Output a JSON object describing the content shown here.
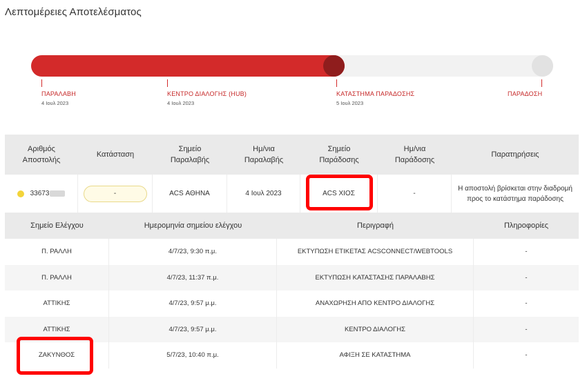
{
  "page": {
    "title": "Λεπτομέρειες Αποτελέσματος"
  },
  "progress": {
    "fraction": 0.6,
    "stages": [
      {
        "name": "ΠΑΡΑΛΑΒΗ",
        "date": "4 Ιουλ 2023"
      },
      {
        "name": "ΚΕΝΤΡΟ ΔΙΑΛΟΓΗΣ (HUB)",
        "date": "4 Ιουλ 2023"
      },
      {
        "name": "ΚΑΤΑΣΤΗΜΑ ΠΑΡΑΔΟΣΗΣ",
        "date": "5 Ιουλ 2023"
      },
      {
        "name": "ΠΑΡΑΔΟΣΗ",
        "date": ""
      }
    ]
  },
  "shipment": {
    "headers": [
      "Αριθμός Αποστολής",
      "Κατάσταση",
      "Σημείο Παραλαβής",
      "Ημ/νια Παραλαβής",
      "Σημείο Παράδοσης",
      "Ημ/νια Παράδοσης",
      "Παρατηρήσεις"
    ],
    "tracking_number": "33673",
    "status": "-",
    "pickup_point": "ACS ΑΘΗΝΑ",
    "pickup_date": "4 Ιουλ 2023",
    "delivery_point": "ACS ΧΙΟΣ",
    "delivery_date": "-",
    "notes": "Η αποστολή βρίσκεται στην διαδρομή προς το κατάστημα παράδοσης"
  },
  "checkpoints": {
    "headers": [
      "Σημείο Ελέγχου",
      "Ημερομηνία σημείου ελέγχου",
      "Περιγραφή",
      "Πληροφορίες"
    ],
    "rows": [
      {
        "point": "Π. ΡΑΛΛΗ",
        "date": "4/7/23, 9:30 π.μ.",
        "description": "ΕΚΤΥΠΩΣΗ ΕΤΙΚΕΤΑΣ ACSCONNECT/WEBTOOLS",
        "info": "-"
      },
      {
        "point": "Π. ΡΑΛΛΗ",
        "date": "4/7/23, 11:37 π.μ.",
        "description": "ΕΚΤΥΠΩΣΗ ΚΑΤΑΣΤΑΣΗΣ ΠΑΡΑΛΑΒΗΣ",
        "info": "-"
      },
      {
        "point": "ΑΤΤΙΚΗΣ",
        "date": "4/7/23, 9:57 μ.μ.",
        "description": "ΑΝΑΧΩΡΗΣΗ ΑΠΟ ΚΕΝΤΡΟ ΔΙΑΛΟΓΗΣ",
        "info": "-"
      },
      {
        "point": "ΑΤΤΙΚΗΣ",
        "date": "4/7/23, 9:57 μ.μ.",
        "description": "ΚΕΝΤΡΟ ΔΙΑΛΟΓΗΣ",
        "info": "-"
      },
      {
        "point": "ΖΑΚΥΝΘΟΣ",
        "date": "5/7/23, 10:40 π.μ.",
        "description": "ΑΦΙΞΗ ΣΕ ΚΑΤΑΣΤΗΜΑ",
        "info": "-"
      }
    ]
  },
  "colors": {
    "accent": "#d32a2a",
    "knob": "#8f1d1d",
    "highlight": "#ff0000",
    "header_bg": "#eaeaea"
  }
}
